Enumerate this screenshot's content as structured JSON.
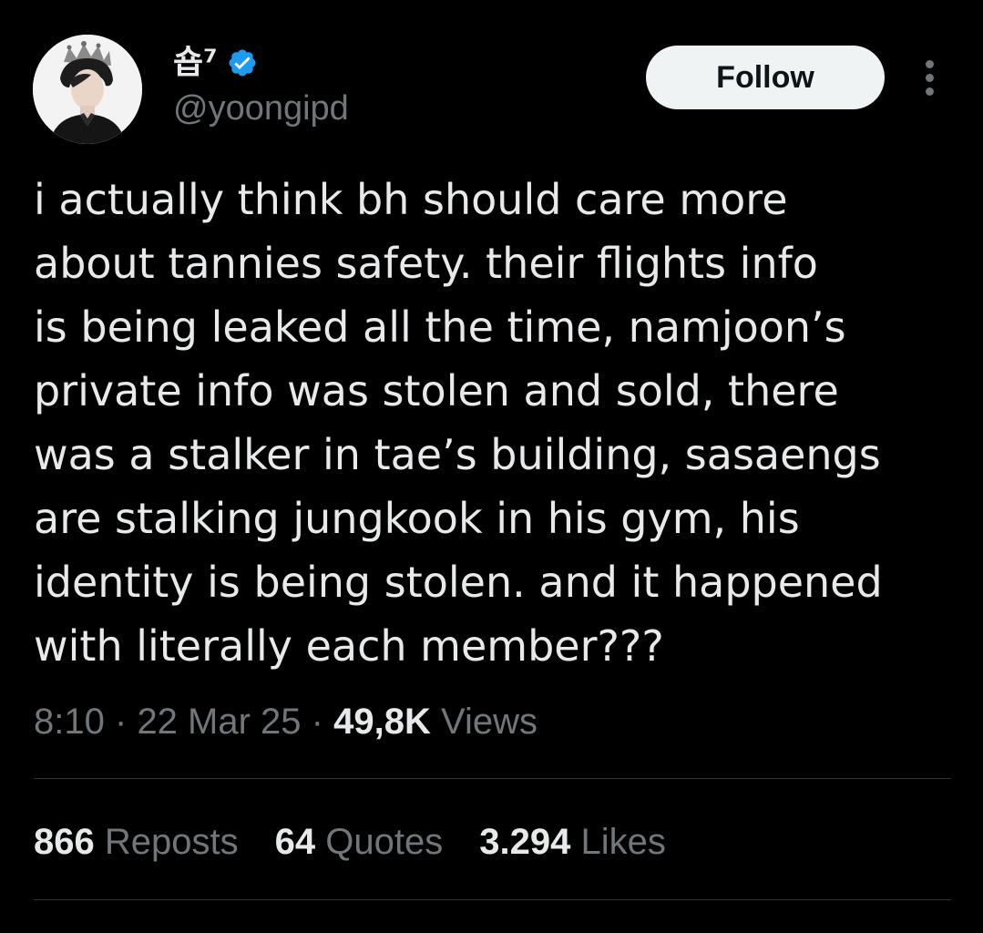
{
  "author": {
    "display_name": "숍⁷",
    "handle": "@yoongipd",
    "verified_icon": "verified-badge-icon",
    "verified_color": "#1d9bf0"
  },
  "actions": {
    "follow_label": "Follow",
    "more_icon": "more-vertical-icon"
  },
  "tweet": {
    "lines": [
      "i actually think bh should care more",
      "about tannies safety. their flights info",
      "is being leaked all the time, namjoon’s",
      "private info was stolen and sold, there",
      "was a stalker in tae’s building, sasaengs",
      "are stalking jungkook in his gym, his",
      "identity is being stolen. and it happened",
      "with literally each member???"
    ],
    "time": "8:10",
    "date": "22 Mar 25",
    "separator": "·",
    "views_count": "49,8K",
    "views_label": "Views"
  },
  "stats": {
    "reposts_count": "866",
    "reposts_label": "Reposts",
    "quotes_count": "64",
    "quotes_label": "Quotes",
    "likes_count": "3.294",
    "likes_label": "Likes"
  },
  "colors": {
    "background": "#000000",
    "text_primary": "#e7e9ea",
    "text_secondary": "#71767b",
    "divider": "#2f3336",
    "follow_button_bg": "#eff3f4"
  }
}
